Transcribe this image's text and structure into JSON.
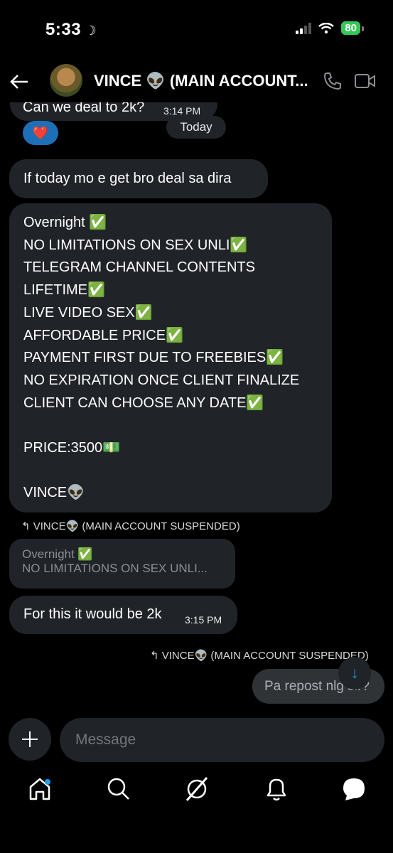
{
  "status": {
    "time": "5:33",
    "battery": "80"
  },
  "header": {
    "title": "VINCE 👽 (MAIN ACCOUNT..."
  },
  "messages": {
    "partial_top": "Can we deal to 2k?",
    "partial_top_time": "3:14 PM",
    "reaction": "❤️",
    "date_divider": "Today",
    "msg1": "If today mo e get bro deal sa dira",
    "offer_lines": [
      "Overnight ✅",
      "NO LIMITATIONS ON SEX UNLI✅",
      "TELEGRAM CHANNEL CONTENTS",
      "LIFETIME✅",
      "LIVE VIDEO SEX✅",
      "AFFORDABLE PRICE✅",
      "PAYMENT FIRST DUE TO FREEBIES✅",
      "NO EXPIRATION ONCE CLIENT FINALIZE",
      "CLIENT CAN CHOOSE ANY DATE✅",
      "",
      "PRICE:3500💵",
      "",
      "VINCE👽"
    ],
    "reply_meta_1": "VINCE👽 (MAIN ACCOUNT SUSPENDED)",
    "quote_line1": "Overnight ✅",
    "quote_line2": "NO LIMITATIONS ON SEX UNLI...",
    "msg2": "For this it would be 2k",
    "msg2_time": "3:15 PM",
    "reply_meta_2": "VINCE👽 (MAIN ACCOUNT SUSPENDED)",
    "msg3": "Pa repost nlg sir?"
  },
  "composer": {
    "placeholder": "Message"
  }
}
